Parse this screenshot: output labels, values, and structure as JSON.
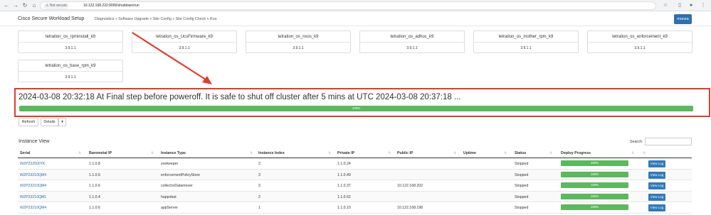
{
  "browser": {
    "secure_label": "Not secure",
    "url": "10.122.168.222:9000/shutdown/run"
  },
  "header": {
    "brand": "Cisco Secure Workload Setup",
    "breadcrumb": "Diagnostics » Software Upgrade » Site Config » Site Config Check » Run",
    "user": "monza"
  },
  "packages": [
    {
      "name": "tetration_os_rpminstall_k9",
      "version": "3.9.1.1"
    },
    {
      "name": "tetration_os_UcsFirmware_k9",
      "version": "3.9.1.1"
    },
    {
      "name": "tetration_os_nxos_k9",
      "version": "3.9.1.1"
    },
    {
      "name": "tetration_os_adhoc_k9",
      "version": "3.9.1.1"
    },
    {
      "name": "tetration_os_mother_rpm_k9",
      "version": "3.9.1.1"
    },
    {
      "name": "tetration_os_enforcement_k9",
      "version": "3.9.1.1"
    },
    {
      "name": "tetration_os_base_rpm_k9",
      "version": "3.9.1.1"
    }
  ],
  "status": {
    "message": "2024-03-08 20:32:18 At Final step before poweroff. It is safe to shut off cluster after 5 mins at UTC 2024-03-08 20:37:18 ...",
    "progress_label": "100%",
    "progress_value": 100
  },
  "toolbar": {
    "refresh": "Refresh",
    "details": "Details",
    "caret": "▾"
  },
  "instance_view": {
    "title": "Instance View",
    "search_label": "Search:",
    "columns": [
      "Serial",
      "Baremetal IP",
      "Instance Type",
      "Instance Index",
      "Private IP",
      "Public IP",
      "Uptime",
      "Status",
      "Deploy Progress"
    ],
    "rows": [
      {
        "serial": "WZP2325007K",
        "baremetal_ip": "1.1.0.8",
        "type": "zookeeper",
        "index": "2",
        "private_ip": "1.1.0.24",
        "public_ip": "",
        "uptime": "",
        "status": "Stopped",
        "progress": "100%",
        "action": "View Log"
      },
      {
        "serial": "WZP23210QM4",
        "baremetal_ip": "1.1.0.6",
        "type": "enforcementPolicyStore",
        "index": "3",
        "private_ip": "1.1.0.49",
        "public_ip": "",
        "uptime": "",
        "status": "Stopped",
        "progress": "100%",
        "action": "View Log"
      },
      {
        "serial": "WZP23210QM4",
        "baremetal_ip": "1.1.0.6",
        "type": "collectorDatamover",
        "index": "3",
        "private_ip": "1.1.0.37",
        "public_ip": "10.122.168.202",
        "uptime": "",
        "status": "Stopped",
        "progress": "100%",
        "action": "View Log"
      },
      {
        "serial": "WZP23210QM1",
        "baremetal_ip": "1.1.0.4",
        "type": "happobat",
        "index": "2",
        "private_ip": "1.1.0.62",
        "public_ip": "",
        "uptime": "",
        "status": "Stopped",
        "progress": "100%",
        "action": "View Log"
      },
      {
        "serial": "WZP23210QM4",
        "baremetal_ip": "1.1.0.6",
        "type": "appServer",
        "index": "1",
        "private_ip": "1.1.0.10",
        "public_ip": "10.122.168.198",
        "uptime": "",
        "status": "Stopped",
        "progress": "100%",
        "action": "View Log"
      }
    ]
  },
  "colors": {
    "accent": "#2f6fad",
    "progress": "#5cb85c",
    "highlight": "#e23a2e"
  }
}
